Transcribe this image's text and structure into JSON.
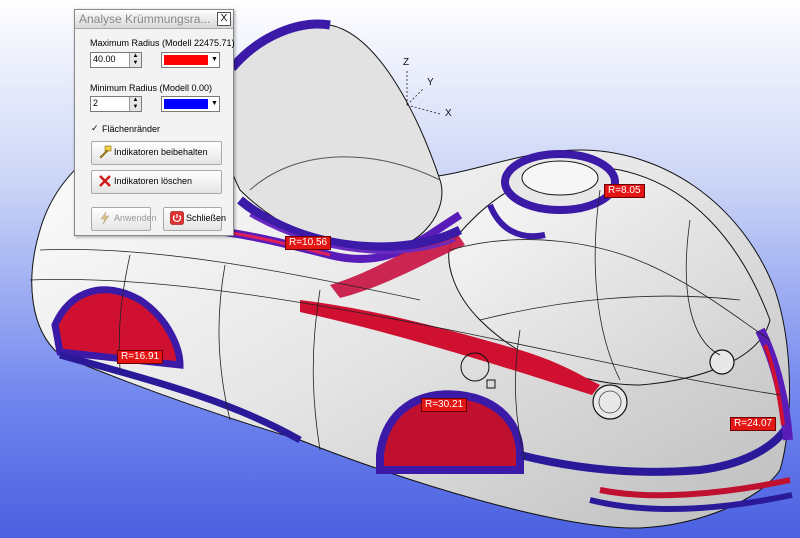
{
  "dialog": {
    "title": "Analyse Krümmungsra...",
    "close_label": "X",
    "max_radius_label": "Maximum Radius (Modell 22475.71)",
    "max_radius_value": "40.00",
    "max_color": "#ff0000",
    "min_radius_label": "Minimum Radius (Modell 0.00)",
    "min_radius_value": "2",
    "min_color": "#0000ff",
    "checkbox_label": "Flächenränder",
    "checkbox_checked": true,
    "btn_keep": "Indikatoren beibehalten",
    "btn_delete": "Indikatoren löschen",
    "btn_apply": "Anwenden",
    "btn_close": "Schließen"
  },
  "axes": {
    "z": "Z",
    "y": "Y",
    "x": "X"
  },
  "indicators": [
    {
      "label": "R=8.05"
    },
    {
      "label": "R=10.56"
    },
    {
      "label": "R=16.91"
    },
    {
      "label": "R=30.21"
    },
    {
      "label": "R=24.07"
    }
  ],
  "colors": {
    "surface": "#e9e9e9",
    "edge_band": "#3a1aa6",
    "high_curvature": "#d01030",
    "background": "#5a70e6"
  }
}
